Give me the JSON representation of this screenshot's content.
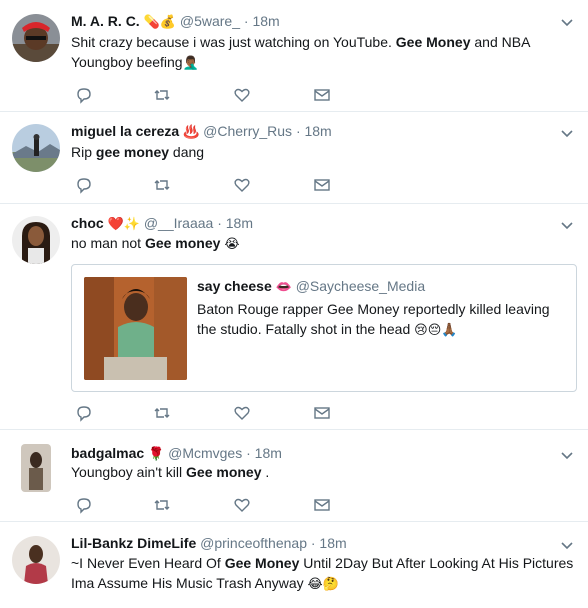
{
  "tweets": [
    {
      "name": "M. A. R. C.",
      "name_emoji": "💊💰",
      "handle": "@5ware_",
      "time": "· 18m",
      "text_a": "Shit crazy because i was just watching on YouTube. ",
      "text_bold": "Gee Money",
      "text_b": " and NBA Youngboy beefing",
      "text_emoji": "🤦🏾‍♂️"
    },
    {
      "name": "miguel la cereza",
      "name_emoji": "♨️",
      "handle": "@Cherry_Rus",
      "time": "· 18m",
      "text_a": "Rip ",
      "text_bold": "gee money",
      "text_b": " dang",
      "text_emoji": ""
    },
    {
      "name": "choc",
      "name_emoji": "❤️✨",
      "handle": "@__Iraaaa",
      "time": "· 18m",
      "text_a": "no man not ",
      "text_bold": "Gee money",
      "text_b": " ",
      "text_emoji": "😭",
      "quote": {
        "name": "say cheese",
        "name_emoji": "👄",
        "handle": "@Saycheese_Media",
        "text": "Baton Rouge rapper Gee Money reportedly killed leaving the studio. Fatally shot in the head",
        "text_emoji": "😢😔🙏🏾"
      }
    },
    {
      "name": "badgalmac",
      "name_emoji": "🌹",
      "handle": "@Mcmvges",
      "time": "· 18m",
      "text_a": "Youngboy ain't kill ",
      "text_bold": "Gee money",
      "text_b": " .",
      "text_emoji": ""
    },
    {
      "name": "Lil-Bankz DimeLife",
      "name_emoji": "",
      "handle": "@princeofthenap",
      "time": "· 18m",
      "text_a": "~I Never Even Heard Of ",
      "text_bold": "Gee Money",
      "text_b": " Until 2Day But After Looking At His Pictures Ima Assume His Music Trash Anyway",
      "text_emoji": "😂🤔"
    }
  ],
  "icons": {
    "reply": "reply-icon",
    "retweet": "retweet-icon",
    "like": "heart-icon",
    "message": "envelope-icon",
    "menu": "chevron-down-icon"
  },
  "colors": {
    "text": "#14171a",
    "muted": "#657786",
    "border": "#e6ecf0",
    "icon": "#657786"
  }
}
